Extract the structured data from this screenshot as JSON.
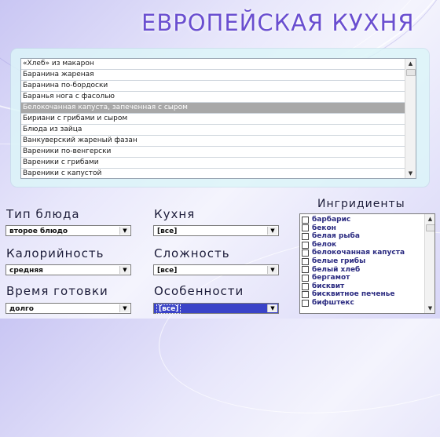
{
  "header": {
    "title": "ЕВРОПЕЙСКАЯ КУХНЯ"
  },
  "dishes": {
    "items": [
      "«Хлеб» из макарон",
      "Баранина жареная",
      "Баранина по-бордоски",
      "Баранья нога с фасолью",
      "Белокочанная капуста, запеченная с сыром",
      "Бириани с грибами и сыром",
      "Блюда из зайца",
      "Ванкуверский жареный фазан",
      "Вареники по-венгерски",
      "Вареники с грибами",
      "Вареники с капустой"
    ],
    "selected_index": 4
  },
  "filters": {
    "dish_type": {
      "label": "Тип блюда",
      "value": "второе блюдо"
    },
    "calories": {
      "label": "Калорийность",
      "value": "средняя"
    },
    "cook_time": {
      "label": "Время готовки",
      "value": "долго"
    },
    "cuisine": {
      "label": "Кухня",
      "value": "[все]"
    },
    "difficulty": {
      "label": "Сложность",
      "value": "[все]"
    },
    "features": {
      "label": "Особенности",
      "value": "[все]"
    }
  },
  "ingredients": {
    "title": "Ингридиенты",
    "items": [
      "барбарис",
      "бекон",
      "белая рыба",
      "белок",
      "белокочанная капуста",
      "белые грибы",
      "белый хлеб",
      "бергамот",
      "бисквит",
      "бисквитное печенье",
      "бифштекс"
    ]
  },
  "icons": {
    "dropdown": "▼",
    "scroll_up": "▲",
    "scroll_down": "▼"
  }
}
